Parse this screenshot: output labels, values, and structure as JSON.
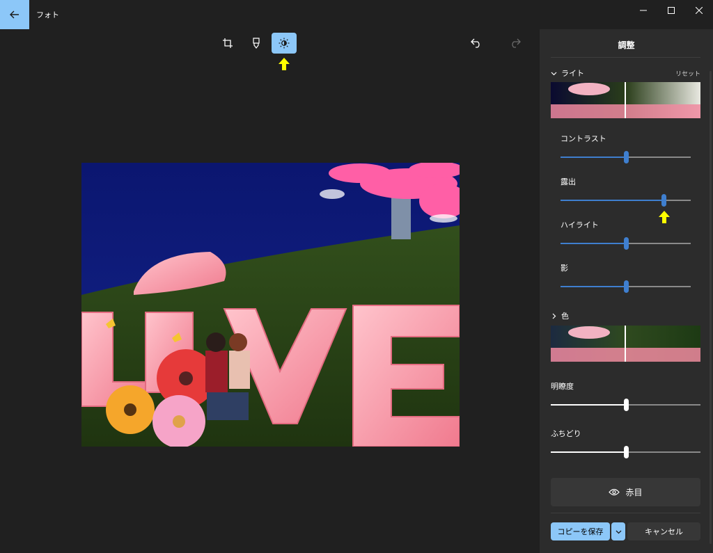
{
  "app": {
    "title": "フォト"
  },
  "toolbar": {
    "tools": [
      {
        "icon": "crop-icon"
      },
      {
        "icon": "markup-pen-icon"
      },
      {
        "icon": "brightness-adjust-icon",
        "active": true
      }
    ],
    "undo_icon": "undo-icon",
    "redo_icon": "redo-icon"
  },
  "panel": {
    "title": "調整",
    "light": {
      "label": "ライト",
      "reset": "リセット",
      "sliders": [
        {
          "label": "コントラスト",
          "value": 0.5
        },
        {
          "label": "露出",
          "value": 0.79
        },
        {
          "label": "ハイライト",
          "value": 0.5
        },
        {
          "label": "影",
          "value": 0.5
        }
      ]
    },
    "color": {
      "label": "色"
    },
    "extra_sliders": [
      {
        "label": "明瞭度",
        "value": 0.5
      },
      {
        "label": "ふちどり",
        "value": 0.5
      }
    ],
    "redeye": "赤目",
    "save": "コピーを保存",
    "cancel": "キャンセル"
  },
  "photo": {
    "text": "LOVE"
  },
  "colors": {
    "accent": "#8cc7f8",
    "slider_blue": "#3f7fcf",
    "highlight_arrow": "#ffff00"
  }
}
